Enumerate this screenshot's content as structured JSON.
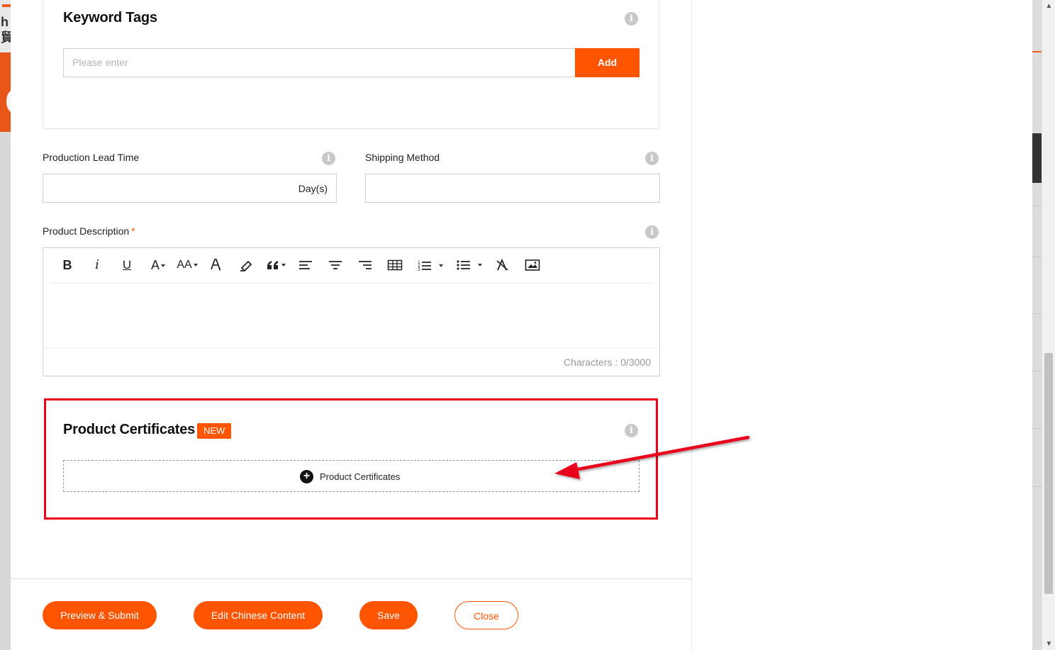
{
  "background": {
    "logo_text": "h\n貿"
  },
  "keyword_tags": {
    "title": "Keyword Tags",
    "input_placeholder": "Please enter",
    "add_label": "Add"
  },
  "production_lead_time": {
    "label": "Production Lead Time",
    "unit": "Day(s)"
  },
  "shipping_method": {
    "label": "Shipping Method"
  },
  "product_description": {
    "label": "Product Description",
    "required_mark": "*",
    "toolbar": [
      "bold",
      "italic",
      "underline",
      "font-color",
      "font-size",
      "background-color",
      "highlight",
      "blockquote",
      "align-left",
      "align-center",
      "align-right",
      "table",
      "ordered-list",
      "bullet-list",
      "clear-format",
      "image"
    ],
    "toolbar_glyphs": {
      "bold": "B",
      "italic": "i",
      "underline": "U",
      "font_color": "A",
      "font_size": "AA"
    },
    "char_count": "Characters : 0/3000"
  },
  "product_certificates": {
    "title": "Product Certificates",
    "badge": "NEW",
    "add_label": "Product Certificates"
  },
  "footer": {
    "preview_submit": "Preview & Submit",
    "edit_chinese": "Edit Chinese Content",
    "save": "Save",
    "close": "Close"
  },
  "colors": {
    "accent": "#ff5500",
    "annotation_red": "#e8001c"
  }
}
